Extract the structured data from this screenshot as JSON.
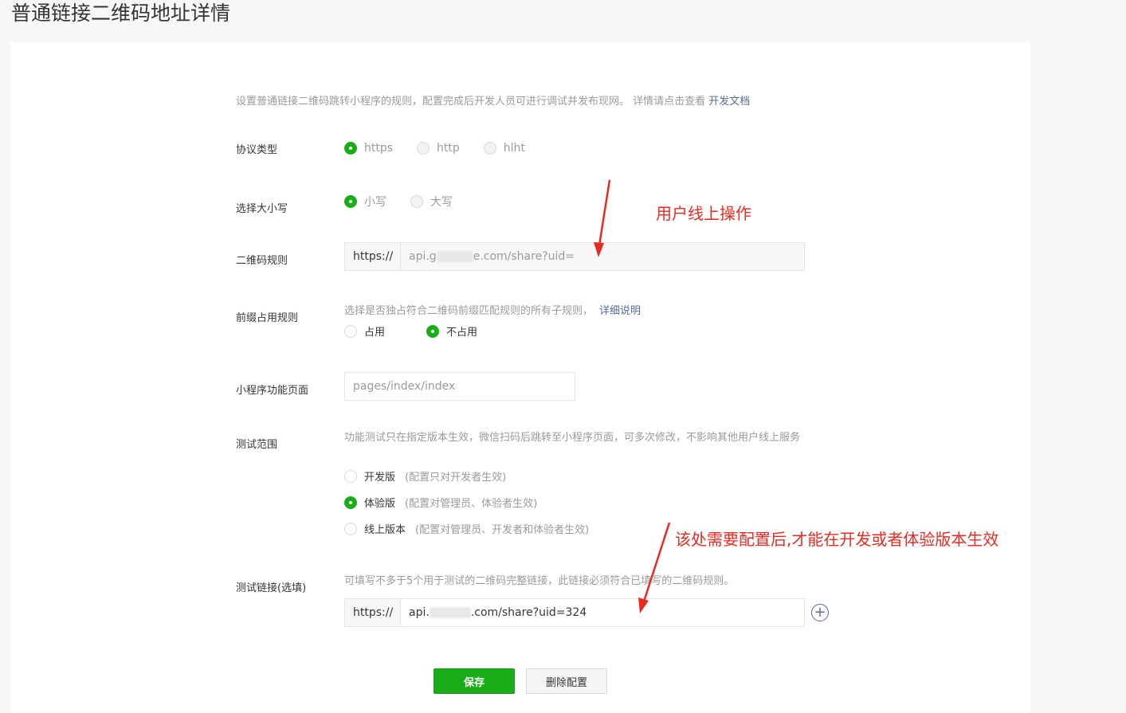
{
  "page": {
    "title": "普通链接二维码地址详情",
    "description": "设置普通链接二维码跳转小程序的规则，配置完成后开发人员可进行调试并发布现网。 详情请点击查看",
    "doc_link": "开发文档"
  },
  "protocol": {
    "label": "协议类型",
    "options": [
      "https",
      "http",
      "hlht"
    ],
    "selected": "https"
  },
  "case": {
    "label": "选择大小写",
    "options": [
      "小写",
      "大写"
    ],
    "selected": "小写"
  },
  "qr_rule": {
    "label": "二维码规则",
    "prefix": "https://",
    "value_start": "api.g",
    "value_end": "e.com/share?uid="
  },
  "prefix_rule": {
    "label": "前缀占用规则",
    "hint": "选择是否独占符合二维码前缀匹配规则的所有子规则，",
    "hint_link": "详细说明",
    "options": [
      "占用",
      "不占用"
    ],
    "selected": "不占用"
  },
  "mini_page": {
    "label": "小程序功能页面",
    "value": "pages/index/index"
  },
  "test_scope": {
    "label": "测试范围",
    "hint": "功能测试只在指定版本生效，微信扫码后跳转至小程序页面，可多次修改，不影响其他用户线上服务",
    "options": [
      {
        "name": "开发版",
        "note": "(配置只对开发者生效)"
      },
      {
        "name": "体验版",
        "note": "(配置对管理员、体验者生效)"
      },
      {
        "name": "线上版本",
        "note": "(配置对管理员、开发者和体验者生效)"
      }
    ],
    "selected": "体验版"
  },
  "test_link": {
    "label": "测试链接(选填)",
    "hint": "可填写不多于5个用于测试的二维码完整链接，此链接必须符合已填写的二维码规则。",
    "prefix": "https://",
    "value_start": "api.",
    "value_end": ".com/share?uid=324",
    "add_icon": "plus-circle-icon"
  },
  "actions": {
    "save": "保存",
    "delete": "删除配置"
  },
  "annotations": {
    "online": "用户线上操作",
    "config_note": "该处需要配置后,才能在开发或者体验版本生效",
    "color": "#ea2a21"
  }
}
